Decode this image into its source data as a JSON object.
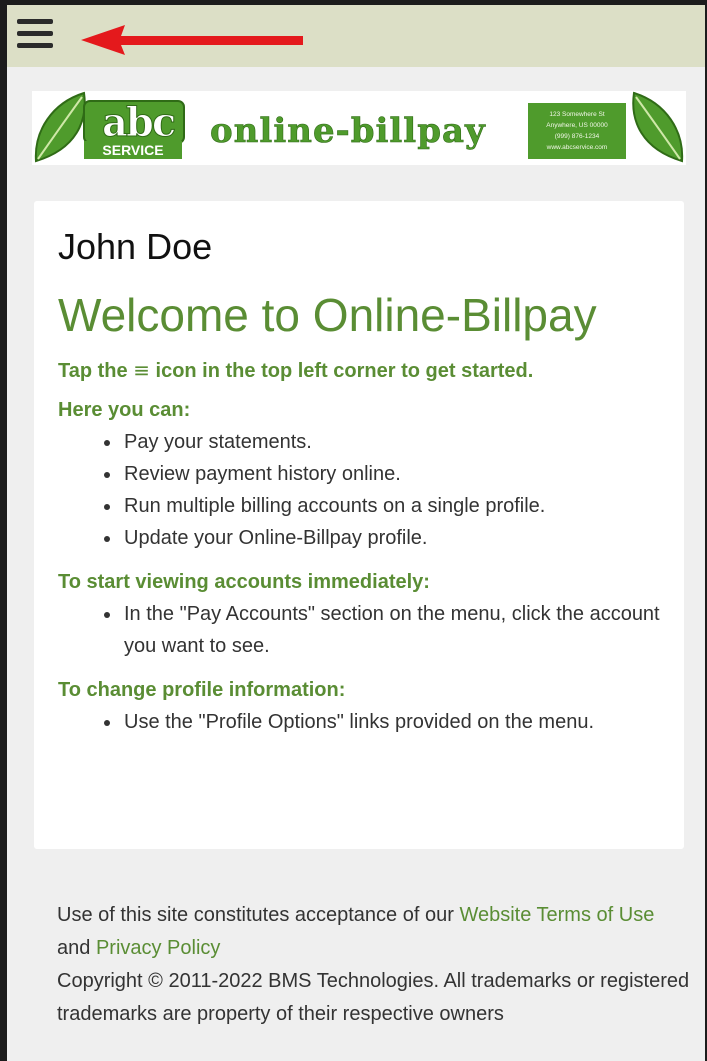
{
  "header": {
    "menu_icon": "hamburger-menu-icon",
    "annotation_icon": "red-arrow-icon",
    "annotation_color": "#e4191c",
    "bar_color": "#dcdfc6"
  },
  "banner": {
    "logo_abc": "abc",
    "logo_service": "SERVICE",
    "logo_title": "online-billpay",
    "address_line1": "123 Somewhere St",
    "address_line2": "Anywhere, US 00000",
    "address_line3": "(999) 876-1234",
    "address_line4": "www.abcservice.com",
    "leaf_icon": "leaf-icon",
    "brand_color": "#4f9b2c"
  },
  "card": {
    "user_name": "John Doe",
    "welcome": "Welcome to Online-Billpay",
    "tap_before": "Tap the ",
    "tap_glyph": "≡",
    "tap_after": " icon in the top left corner to get started.",
    "sections": [
      {
        "heading": "Here you can:",
        "items": [
          "Pay your statements.",
          "Review payment history online.",
          "Run multiple billing accounts on a single profile.",
          "Update your Online-Billpay profile."
        ]
      },
      {
        "heading": "To start viewing accounts immediately:",
        "items": [
          "In the \"Pay Accounts\" section on the menu, click the account you want to see."
        ]
      },
      {
        "heading": "To change profile information:",
        "items": [
          "Use the \"Profile Options\" links provided on the menu."
        ]
      }
    ]
  },
  "footer": {
    "acceptance_prefix": "Use of this site constitutes acceptance of our ",
    "terms_link": "Website Terms of Use",
    "and_text": " and ",
    "privacy_link": "Privacy Policy",
    "copyright": "Copyright © 2011-2022 BMS Technologies. All trademarks or registered trademarks are property of their respective owners",
    "link_color": "#5a8d34"
  }
}
